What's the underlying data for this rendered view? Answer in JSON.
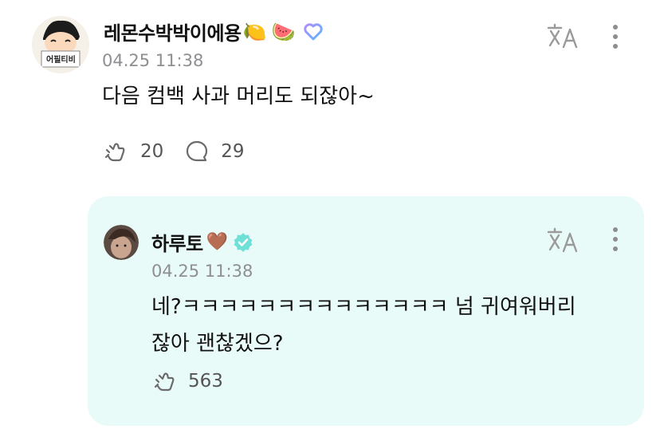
{
  "post": {
    "author": "레몬수박박이에용",
    "emojis": [
      "🍋",
      "🍉"
    ],
    "timestamp": "04.25 11:38",
    "text": "다음 컴백 사과 머리도 되잖아~",
    "likes": "20",
    "comments": "29",
    "avatar_sign_text": "어필티비"
  },
  "reply": {
    "author": "하루토",
    "emoji": "🤎",
    "timestamp": "04.25 11:38",
    "text_line1": "네?ㅋㅋㅋㅋㅋㅋㅋㅋㅋㅋㅋㅋㅋㅋ 넘 귀여워버리",
    "text_line2": "잖아 괜찮겠으?",
    "likes": "563"
  },
  "colors": {
    "reply_bg": "#e9fbf8",
    "verified": "#6ee0d6",
    "muted": "#8e8e93"
  }
}
